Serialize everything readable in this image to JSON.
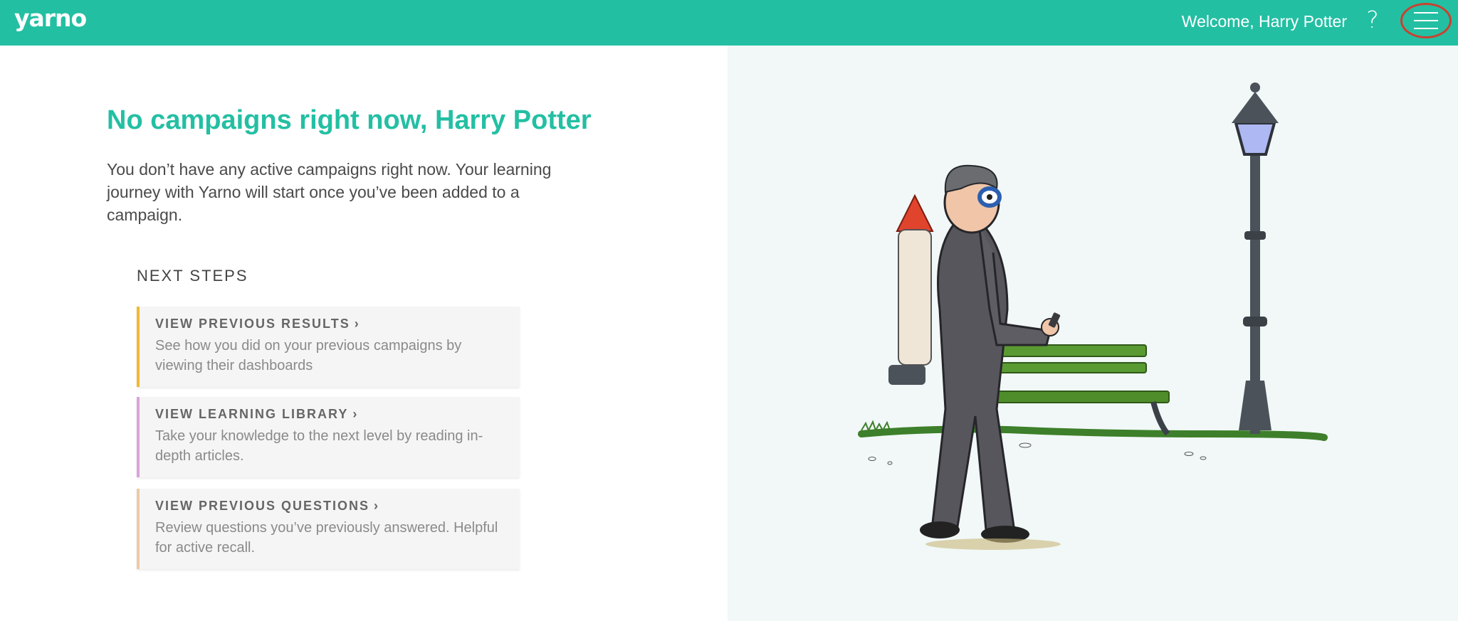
{
  "header": {
    "logo": "yarno",
    "welcome": "Welcome, Harry Potter",
    "help_label": "?",
    "menu_icon": "hamburger-menu-icon"
  },
  "main": {
    "heading": "No campaigns right now, Harry Potter",
    "intro": "You don’t have any active campaigns right now. Your learning journey with Yarno will start once you’ve been added to a campaign.",
    "next_steps_title": "NEXT STEPS",
    "cards": [
      {
        "title": "VIEW PREVIOUS RESULTS",
        "desc": "See how you did on your previous campaigns by viewing their dashboards",
        "accent": "#f0b92f"
      },
      {
        "title": "VIEW LEARNING LIBRARY",
        "desc": "Take your knowledge to the next level by reading in-depth articles.",
        "accent": "#d9a3da"
      },
      {
        "title": "VIEW PREVIOUS QUESTIONS",
        "desc": "Review questions you’ve previously answered. Helpful for active recall.",
        "accent": "#ecc9a6"
      }
    ]
  },
  "colors": {
    "brand": "#23bfa3",
    "panel_bg": "#f1f8f7",
    "menu_highlight": "#c9422f"
  }
}
